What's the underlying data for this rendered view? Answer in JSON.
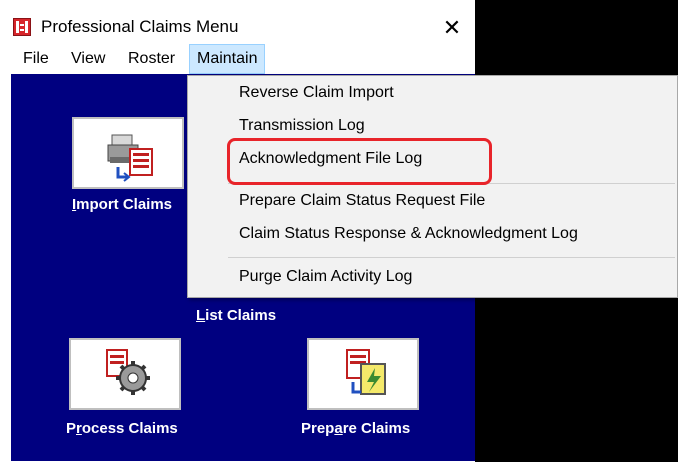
{
  "window": {
    "title": "Professional Claims Menu",
    "close_glyph": "✕"
  },
  "menubar": {
    "file": "File",
    "view": "View",
    "roster": "Roster",
    "maintain": "Maintain"
  },
  "dropdown": {
    "items": [
      "Reverse Claim Import",
      "Transmission Log",
      "Acknowledgment File Log",
      "Prepare Claim Status Request File",
      "Claim Status Response & Acknowledgment Log",
      "Purge Claim Activity Log"
    ],
    "highlighted_item": "Acknowledgment File Log",
    "highlight_color": "#e8242a"
  },
  "tiles": {
    "import": {
      "mnemonic": "I",
      "rest": "mport Claims",
      "icon": "printer-import-icon"
    },
    "list": {
      "mnemonic": "L",
      "rest": "ist Claims"
    },
    "process": {
      "pre": "P",
      "mnemonic": "r",
      "rest": "ocess Claims",
      "icon": "gear-document-icon"
    },
    "prepare": {
      "pre": "Prep",
      "mnemonic": "a",
      "rest": "re Claims",
      "icon": "prepare-document-icon"
    }
  },
  "colors": {
    "window_bg": "#000080",
    "menu_active": "#cce8ff",
    "outside_bg": "#000000"
  }
}
